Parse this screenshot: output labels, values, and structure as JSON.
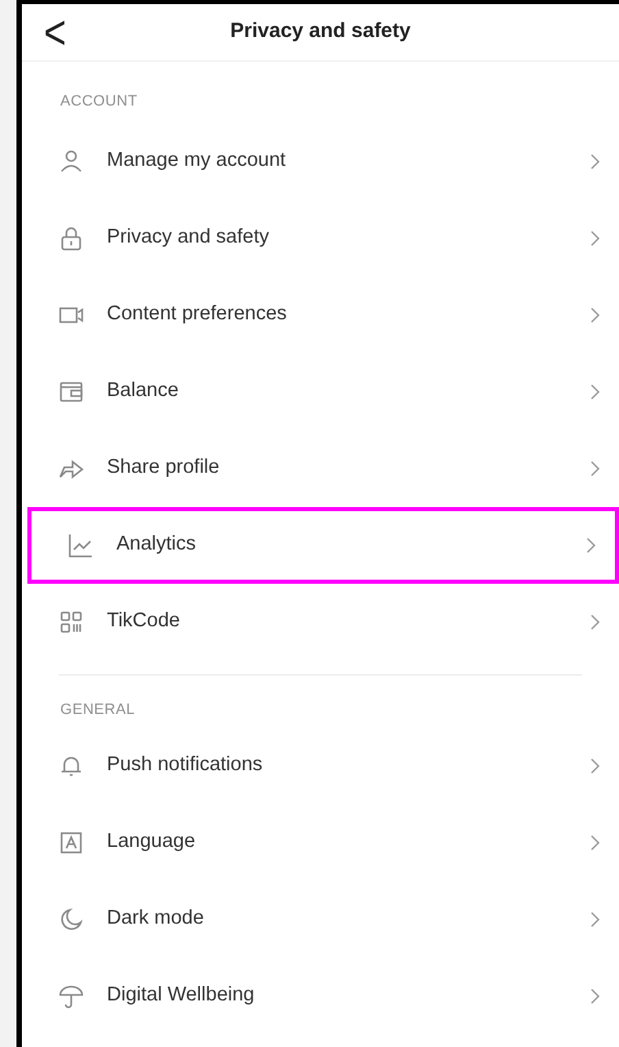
{
  "header": {
    "back": "<",
    "title": "Privacy and safety"
  },
  "sections": [
    {
      "title": "ACCOUNT",
      "items": [
        {
          "label": "Manage my account",
          "highlighted": false
        },
        {
          "label": "Privacy and safety",
          "highlighted": false
        },
        {
          "label": "Content preferences",
          "highlighted": false
        },
        {
          "label": "Balance",
          "highlighted": false
        },
        {
          "label": "Share profile",
          "highlighted": false
        },
        {
          "label": "Analytics",
          "highlighted": true
        },
        {
          "label": "TikCode",
          "highlighted": false
        }
      ]
    },
    {
      "title": "GENERAL",
      "items": [
        {
          "label": "Push notifications",
          "highlighted": false
        },
        {
          "label": "Language",
          "highlighted": false
        },
        {
          "label": "Dark mode",
          "highlighted": false
        },
        {
          "label": "Digital Wellbeing",
          "highlighted": false
        }
      ]
    }
  ]
}
